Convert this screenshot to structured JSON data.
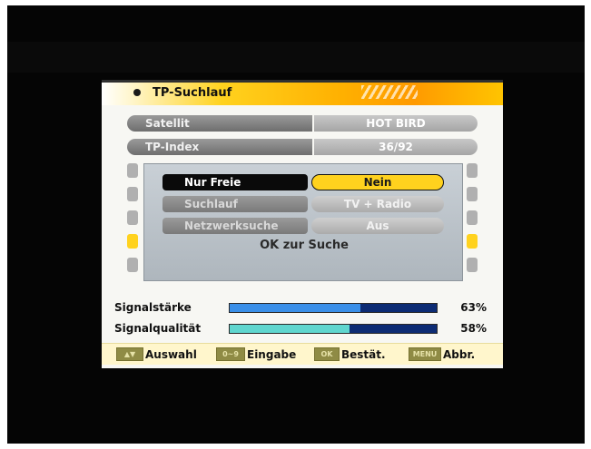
{
  "title": "TP-Suchlauf",
  "settings": [
    {
      "label": "Satellit",
      "value": "HOT BIRD"
    },
    {
      "label": "TP-Index",
      "value": "36/92"
    }
  ],
  "dialog": {
    "rows": [
      {
        "label": "Nur Freie",
        "value": "Nein"
      },
      {
        "label": "Suchlauf",
        "value": "TV + Radio"
      },
      {
        "label": "Netzwerksuche",
        "value": "Aus"
      }
    ],
    "ok_text": "OK zur Suche"
  },
  "meters": [
    {
      "label": "Signalstärke",
      "percent_text": "63%",
      "value": 63,
      "color": "#3a8fe8"
    },
    {
      "label": "Signalqualität",
      "percent_text": "58%",
      "value": 58,
      "color": "#5fd6cf"
    }
  ],
  "help": [
    {
      "key": "▲▼",
      "label": "Auswahl"
    },
    {
      "key": "0~9",
      "label": "Eingabe"
    },
    {
      "key": "OK",
      "label": "Bestät."
    },
    {
      "key": "MENU",
      "label": "Abbr."
    }
  ],
  "colors": {
    "accent_yellow": "#ffd21e",
    "title_orange": "#ff9a00",
    "meter_track": "#0d2c74"
  }
}
